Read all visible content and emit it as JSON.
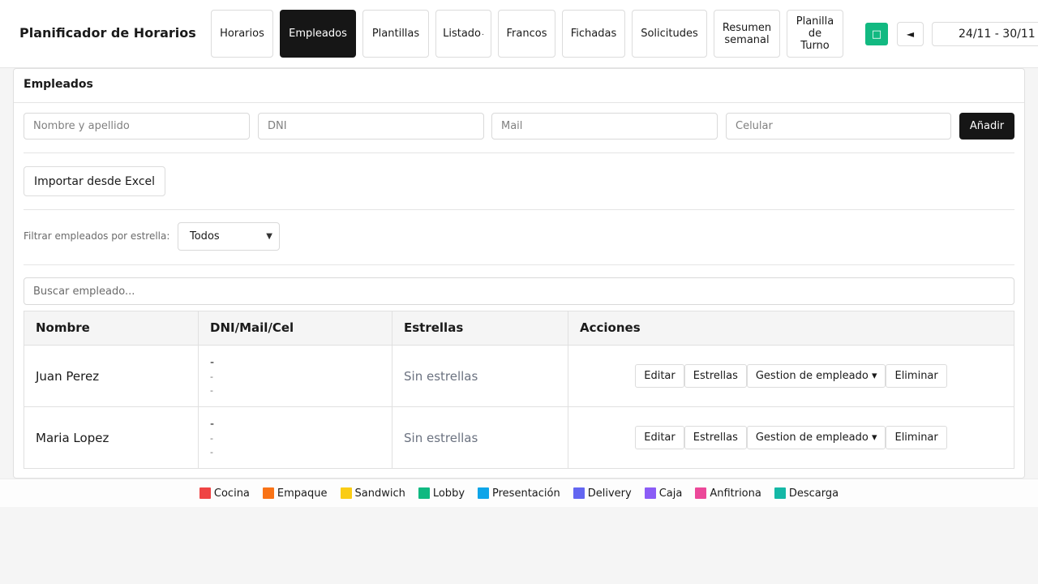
{
  "app": {
    "title": "Planificador de Horarios"
  },
  "nav": {
    "items": [
      {
        "label": "Horarios"
      },
      {
        "label": "Empleados",
        "active": true
      },
      {
        "label": "Plantillas"
      },
      {
        "label": "Listado"
      },
      {
        "label": "Francos"
      },
      {
        "label": "Fichadas"
      },
      {
        "label": "Solicitudes"
      },
      {
        "label": "Resumen\nsemanal"
      },
      {
        "label": "Planilla\nde\nTurno"
      }
    ],
    "prev_icon": "◄",
    "date_range": "24/11 - 30/11"
  },
  "employees_panel": {
    "title": "Empleados",
    "form": {
      "name_placeholder": "Nombre y apellido",
      "dni_placeholder": "DNI",
      "mail_placeholder": "Mail",
      "phone_placeholder": "Celular",
      "add_label": "Añadir"
    },
    "import_label": "Importar desde Excel",
    "filter": {
      "label": "Filtrar empleados por estrella:",
      "selected": "Todos"
    },
    "search_placeholder": "Buscar empleado...",
    "table": {
      "headers": [
        "Nombre",
        "DNI/Mail/Cel",
        "Estrellas",
        "Acciones"
      ],
      "rows": [
        {
          "name": "Juan Perez",
          "dni": "-",
          "mail": "-",
          "cel": "-",
          "stars": "Sin estrellas"
        },
        {
          "name": "Maria Lopez",
          "dni": "-",
          "mail": "-",
          "cel": "-",
          "stars": "Sin estrellas"
        }
      ],
      "actions": {
        "edit": "Editar",
        "stars": "Estrellas",
        "manage": "Gestion de empleado ▾",
        "delete": "Eliminar"
      }
    }
  },
  "legend": [
    {
      "label": "Cocina",
      "color": "#ef4444"
    },
    {
      "label": "Empaque",
      "color": "#f97316"
    },
    {
      "label": "Sandwich",
      "color": "#facc15"
    },
    {
      "label": "Lobby",
      "color": "#10b981"
    },
    {
      "label": "Presentación",
      "color": "#0ea5e9"
    },
    {
      "label": "Delivery",
      "color": "#6366f1"
    },
    {
      "label": "Caja",
      "color": "#8b5cf6"
    },
    {
      "label": "Anfitriona",
      "color": "#ec4899"
    },
    {
      "label": "Descarga",
      "color": "#14b8a6"
    }
  ]
}
